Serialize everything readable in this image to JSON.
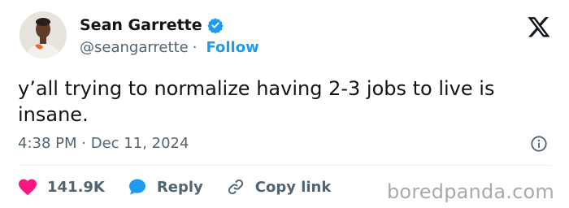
{
  "author": {
    "name": "Sean Garrette",
    "handle": "@seangarrette",
    "separator": "·",
    "follow_label": "Follow"
  },
  "tweet": {
    "text": "y’all trying to normalize having 2-3 jobs to live is insane.",
    "time": "4:38 PM",
    "date_separator": "·",
    "date": "Dec 11, 2024"
  },
  "actions": {
    "likes": "141.9K",
    "reply_label": "Reply",
    "copy_link_label": "Copy link"
  },
  "watermark": "boredpanda.com",
  "colors": {
    "accent": "#1d9bf0",
    "like": "#f91880",
    "muted": "#536471",
    "text": "#0f1419"
  },
  "icons": {
    "verified": "verified-badge-icon",
    "platform": "x-logo-icon",
    "info": "info-icon",
    "like": "heart-icon",
    "reply": "speech-bubble-icon",
    "copy_link": "link-icon"
  }
}
